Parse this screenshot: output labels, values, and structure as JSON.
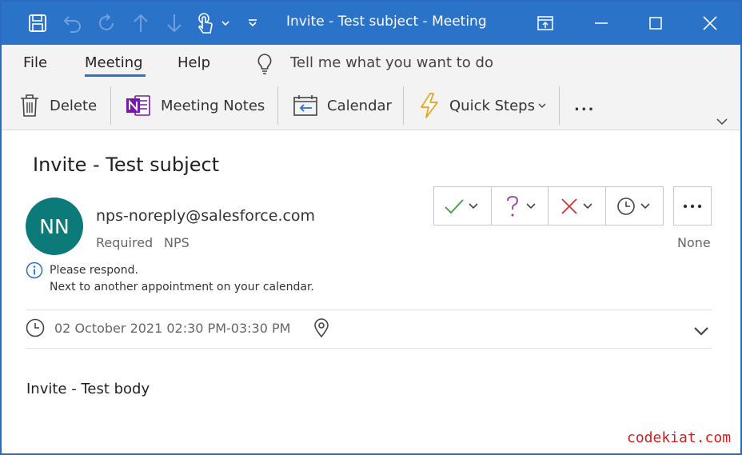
{
  "window": {
    "title": "Invite - Test subject  -  Meeting"
  },
  "colors": {
    "titlebar": "#2b72c9",
    "accent": "#2b72c9",
    "avatar": "#0b7a79",
    "accept": "#3a9a3f",
    "tentative": "#9b3a9b",
    "decline": "#d13438",
    "watermark": "#d21e1e"
  },
  "quick_access": [
    "save-icon",
    "undo-icon",
    "redo-icon",
    "up-arrow-icon",
    "down-arrow-icon",
    "touch-mode-icon",
    "customize-toolbar-icon"
  ],
  "menu": {
    "tabs": [
      "File",
      "Meeting",
      "Help"
    ],
    "active_tab": "Meeting",
    "tell_me": "Tell me what you want to do"
  },
  "ribbon": {
    "delete": "Delete",
    "meeting_notes": "Meeting Notes",
    "calendar": "Calendar",
    "quick_steps": "Quick Steps",
    "more": "..."
  },
  "message": {
    "subject": "Invite - Test subject",
    "avatar_initials": "NN",
    "sender": "nps-noreply@salesforce.com",
    "required_label": "Required",
    "required_attendee": "NPS",
    "response_status": "None",
    "notice_line1": "Please respond.",
    "notice_line2": "Next to another appointment on your calendar.",
    "datetime": "02 October 2021 02:30 PM-03:30 PM",
    "body": "Invite - Test body"
  },
  "watermark": "codekiat.com"
}
